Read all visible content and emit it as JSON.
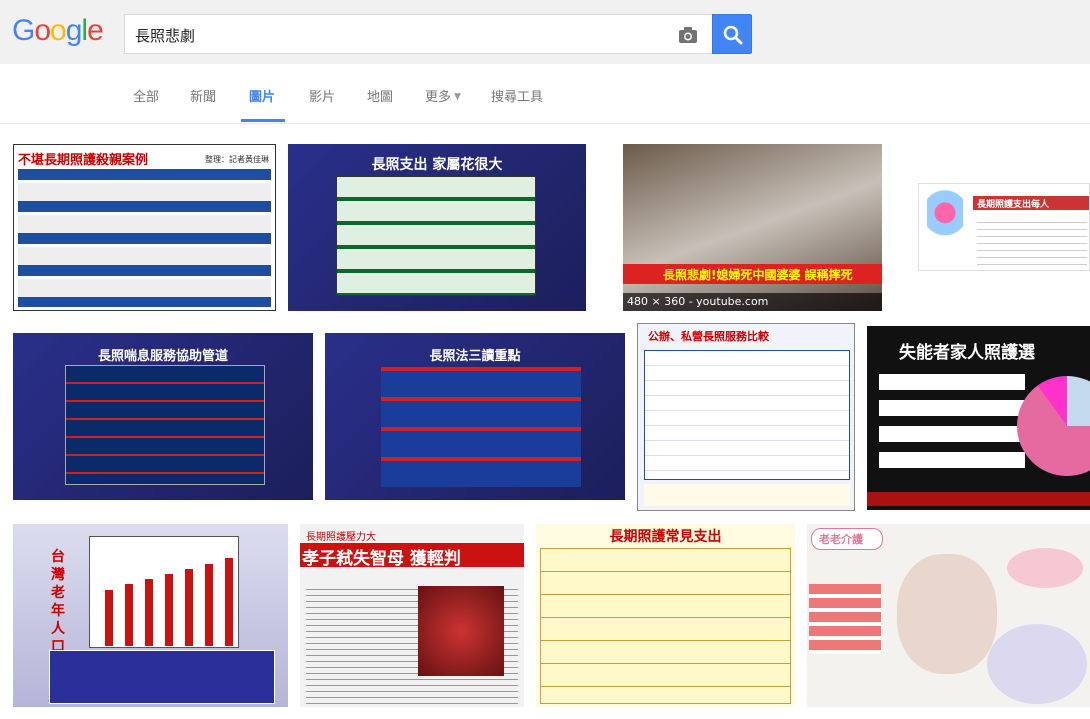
{
  "logo": {
    "letters": [
      "G",
      "o",
      "o",
      "g",
      "l",
      "e"
    ],
    "colors": [
      "#4285f4",
      "#ea4335",
      "#fbbc05",
      "#4285f4",
      "#34a853",
      "#ea4335"
    ]
  },
  "search": {
    "query": "長照悲劇"
  },
  "colors": {
    "accent": "#4285f4",
    "tab_text": "#777777",
    "header_bg": "#f1f1f1"
  },
  "tabs": [
    {
      "label": "全部"
    },
    {
      "label": "新聞"
    },
    {
      "label": "圖片",
      "active": true
    },
    {
      "label": "影片"
    },
    {
      "label": "地圖"
    },
    {
      "label": "更多"
    },
    {
      "label": "搜尋工具"
    }
  ],
  "results": [
    {
      "title": "不堪長期照護殺親案例",
      "subtitle": "整理：記者黃佳琳"
    },
    {
      "title": "長照支出 家屬花很大"
    },
    {
      "title": "長照悲劇!媳婦死中國婆婆 誤稱摔死",
      "caption": "480 × 360 - youtube.com"
    },
    {
      "title": "長期照護支出每人"
    },
    {
      "title": "長照喘息服務協助管道"
    },
    {
      "title": "長照法三讀重點"
    },
    {
      "title": "公辦、私營長照服務比較"
    },
    {
      "title": "失能者家人照護選"
    },
    {
      "title": "台灣老年人口"
    },
    {
      "title": "孝子弒失智母 獲輕判",
      "subtitle": "長期照護壓力大"
    },
    {
      "title": "長期照護常見支出"
    },
    {
      "title": "老老介護"
    }
  ]
}
